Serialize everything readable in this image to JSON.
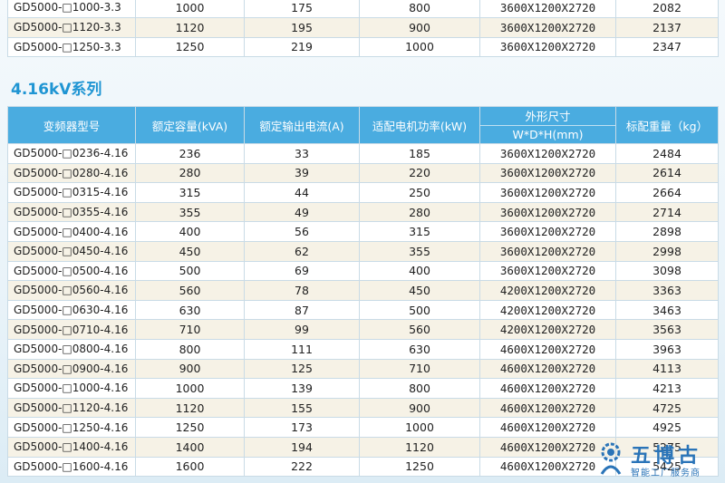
{
  "top_table": {
    "rows": [
      [
        "GD5000-□1000-3.3",
        "1000",
        "175",
        "800",
        "3600X1200X2720",
        "2082"
      ],
      [
        "GD5000-□1120-3.3",
        "1120",
        "195",
        "900",
        "3600X1200X2720",
        "2137"
      ],
      [
        "GD5000-□1250-3.3",
        "1250",
        "219",
        "1000",
        "3600X1200X2720",
        "2347"
      ]
    ]
  },
  "section": {
    "title": "4.16kV系列"
  },
  "main_table": {
    "headers": {
      "model": "变频器型号",
      "capacity": "额定容量(kVA)",
      "current": "额定输出电流(A)",
      "motor_power": "适配电机功率(kW)",
      "dims_top": "外形尺寸",
      "dims_sub": "W*D*H(mm)",
      "weight": "标配重量（kg）"
    },
    "rows": [
      [
        "GD5000-□0236-4.16",
        "236",
        "33",
        "185",
        "3600X1200X2720",
        "2484"
      ],
      [
        "GD5000-□0280-4.16",
        "280",
        "39",
        "220",
        "3600X1200X2720",
        "2614"
      ],
      [
        "GD5000-□0315-4.16",
        "315",
        "44",
        "250",
        "3600X1200X2720",
        "2664"
      ],
      [
        "GD5000-□0355-4.16",
        "355",
        "49",
        "280",
        "3600X1200X2720",
        "2714"
      ],
      [
        "GD5000-□0400-4.16",
        "400",
        "56",
        "315",
        "3600X1200X2720",
        "2898"
      ],
      [
        "GD5000-□0450-4.16",
        "450",
        "62",
        "355",
        "3600X1200X2720",
        "2998"
      ],
      [
        "GD5000-□0500-4.16",
        "500",
        "69",
        "400",
        "3600X1200X2720",
        "3098"
      ],
      [
        "GD5000-□0560-4.16",
        "560",
        "78",
        "450",
        "4200X1200X2720",
        "3363"
      ],
      [
        "GD5000-□0630-4.16",
        "630",
        "87",
        "500",
        "4200X1200X2720",
        "3463"
      ],
      [
        "GD5000-□0710-4.16",
        "710",
        "99",
        "560",
        "4200X1200X2720",
        "3563"
      ],
      [
        "GD5000-□0800-4.16",
        "800",
        "111",
        "630",
        "4600X1200X2720",
        "3963"
      ],
      [
        "GD5000-□0900-4.16",
        "900",
        "125",
        "710",
        "4600X1200X2720",
        "4113"
      ],
      [
        "GD5000-□1000-4.16",
        "1000",
        "139",
        "800",
        "4600X1200X2720",
        "4213"
      ],
      [
        "GD5000-□1120-4.16",
        "1120",
        "155",
        "900",
        "4600X1200X2720",
        "4725"
      ],
      [
        "GD5000-□1250-4.16",
        "1250",
        "173",
        "1000",
        "4600X1200X2720",
        "4925"
      ],
      [
        "GD5000-□1400-4.16",
        "1400",
        "194",
        "1120",
        "4600X1200X2720",
        "5275"
      ],
      [
        "GD5000-□1600-4.16",
        "1600",
        "222",
        "1250",
        "4600X1200X2720",
        "5425"
      ]
    ]
  },
  "watermark": {
    "main": "五博古",
    "sub": "智能工厂服务商",
    "icon": "gear-person-logo-icon",
    "color": "#2a74b8"
  }
}
